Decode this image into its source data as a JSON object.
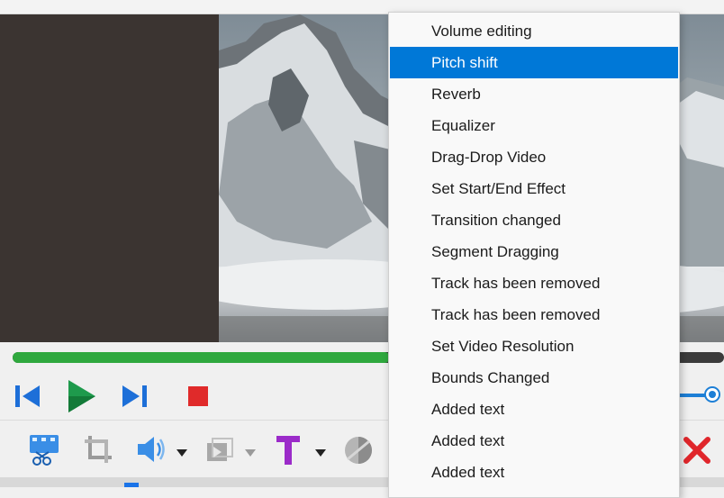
{
  "menu": {
    "items": [
      {
        "label": "Volume editing"
      },
      {
        "label": "Pitch shift",
        "selected": true
      },
      {
        "label": "Reverb"
      },
      {
        "label": "Equalizer"
      },
      {
        "label": "Drag-Drop Video"
      },
      {
        "label": "Set Start/End Effect"
      },
      {
        "label": "Transition changed"
      },
      {
        "label": "Segment Dragging"
      },
      {
        "label": "Track has been removed"
      },
      {
        "label": "Track has been removed"
      },
      {
        "label": "Set Video Resolution"
      },
      {
        "label": "Bounds Changed"
      },
      {
        "label": "Added text"
      },
      {
        "label": "Added text"
      },
      {
        "label": "Added text"
      }
    ]
  },
  "player": {
    "progress_fraction": 0.53,
    "volume_fraction": 0.9
  },
  "colors": {
    "accent": "#0078d7",
    "progress": "#2fa83e",
    "play": "#1e9a4c",
    "nav": "#1d6fd8",
    "stop": "#e02a2a",
    "text_tool": "#9b2bc9",
    "close": "#e0262b"
  },
  "icons": {
    "prev": "skip-previous-icon",
    "play": "play-icon",
    "next": "skip-next-icon",
    "stop": "stop-icon",
    "edit_video": "edit-video-icon",
    "crop": "crop-icon",
    "audio": "speaker-icon",
    "transition": "transition-icon",
    "text": "text-tool-icon",
    "effect": "effect-circle-icon",
    "close": "close-icon"
  }
}
